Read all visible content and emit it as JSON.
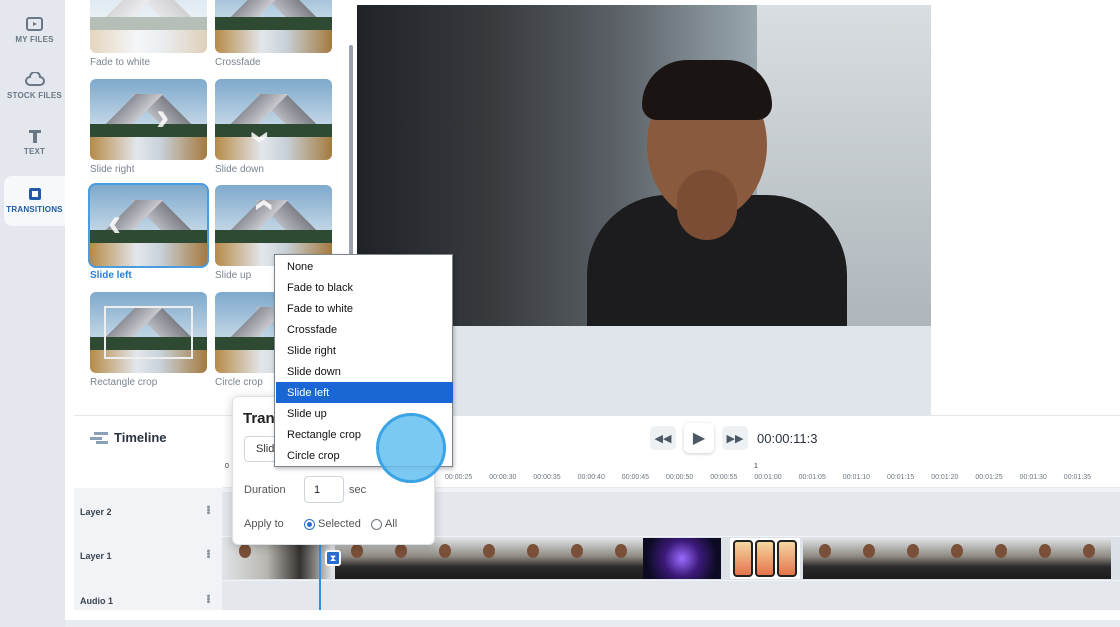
{
  "sidebar": {
    "items": [
      {
        "label": "MY FILES",
        "icon": "film-folder-icon"
      },
      {
        "label": "STOCK FILES",
        "icon": "cloud-icon"
      },
      {
        "label": "TEXT",
        "icon": "text-T-icon"
      },
      {
        "label": "TRANSITIONS",
        "icon": "transitions-icon",
        "active": true
      }
    ]
  },
  "transitions_panel": {
    "thumbs": [
      {
        "label": "Fade to white"
      },
      {
        "label": "Crossfade"
      },
      {
        "label": "Slide right"
      },
      {
        "label": "Slide down"
      },
      {
        "label": "Slide left",
        "selected": true
      },
      {
        "label": "Slide up"
      },
      {
        "label": "Rectangle crop"
      },
      {
        "label": "Circle crop"
      }
    ]
  },
  "timeline": {
    "title": "Timeline",
    "timecode": "00:00:11:3",
    "ruler_major": [
      "0",
      "1"
    ],
    "ruler_ticks": [
      "00:00:25",
      "00:00:30",
      "00:00:35",
      "00:00:40",
      "00:00:45",
      "00:00:50",
      "00:00:55",
      "00:01:00",
      "00:01:05",
      "00:01:10",
      "00:01:15",
      "00:01:20",
      "00:01:25",
      "00:01:30",
      "00:01:35"
    ],
    "tracks": [
      "Layer 2",
      "Layer 1",
      "Audio 1"
    ]
  },
  "transition_popup": {
    "title": "Tran",
    "select_value": "Slid",
    "duration_label": "Duration",
    "duration_value": "1",
    "duration_unit": "sec",
    "apply_label": "Apply to",
    "apply_options": [
      {
        "label": "Selected",
        "checked": true
      },
      {
        "label": "All",
        "checked": false
      }
    ]
  },
  "dropdown": {
    "options": [
      "None",
      "Fade to black",
      "Fade to white",
      "Crossfade",
      "Slide right",
      "Slide down",
      "Slide left",
      "Slide up",
      "Rectangle crop",
      "Circle crop"
    ],
    "highlighted": "Slide left"
  },
  "colors": {
    "accent": "#1a66d4",
    "selection": "#4a9be0",
    "playhead": "#2f8fe0"
  }
}
